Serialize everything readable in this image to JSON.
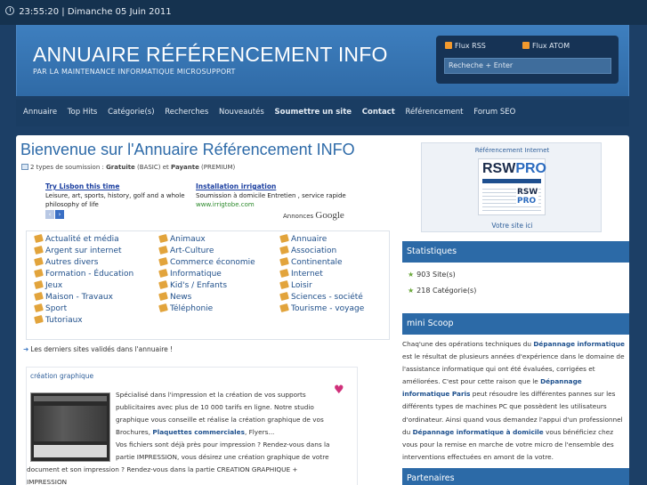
{
  "topbar": {
    "datetime": "23:55:20 | Dimanche 05 Juin 2011"
  },
  "header": {
    "title": "ANNUAIRE RÉFÉRENCEMENT INFO",
    "tagline": "PAR LA MAINTENANCE INFORMATIQUE MICROSUPPORT",
    "feed_rss": "Flux RSS",
    "feed_atom": "Flux ATOM",
    "search_value": "Recheche + Enter"
  },
  "nav": {
    "items": [
      "Annuaire",
      "Top Hits",
      "Catégorie(s)",
      "Recherches",
      "Nouveautés",
      "Soumettre un site",
      "Contact",
      "Référencement",
      "Forum SEO"
    ]
  },
  "main": {
    "title": "Bienvenue sur l'Annuaire Référencement INFO",
    "subline_prefix": "2 types de soumission : ",
    "subline_free": "Gratuite",
    "subline_basic": " (BASIC) et ",
    "subline_paid": "Payante",
    "subline_premium": " (PREMIUM)",
    "ads": [
      {
        "title": "Try Lisbon this time",
        "text": "Leisure, art, sports, history, golf and a whole philosophy of life",
        "url": ""
      },
      {
        "title": "Installation irrigation",
        "text": "Soumission à domicile Entretien , service rapide",
        "url": "www.irrigtobe.com"
      }
    ],
    "ads_by": "Annonces",
    "ads_brand": "Google",
    "categories": [
      [
        "Actualité et média",
        "Animaux",
        "Annuaire"
      ],
      [
        "Argent sur internet",
        "Art-Culture",
        "Association"
      ],
      [
        "Autres divers",
        "Commerce économie",
        "Continentale"
      ],
      [
        "Formation - Éducation",
        "Informatique",
        "Internet"
      ],
      [
        "Jeux",
        "Kid's / Enfants",
        "Loisir"
      ],
      [
        "Maison - Travaux",
        "News",
        "Sciences - société"
      ],
      [
        "Sport",
        "Téléphonie",
        "Tourisme - voyage"
      ],
      [
        "Tutoriaux",
        "",
        ""
      ]
    ],
    "latest_label": "Les derniers sites validés dans l'annuaire !",
    "card": {
      "title": "création graphique",
      "lines": [
        "Spécialisé dans l'impression et la création de vos supports",
        "publicitaires avec plus de 10 000 tarifs en ligne. Notre studio",
        "graphique vous conseille et réalise la création graphique de vos",
        "Brochures, ",
        "Plaquettes commerciales",
        ", Flyers...",
        "Vos fichiers sont déjà près pour impression ? Rendez-vous dans la",
        "partie IMPRESSION, vous désirez une création graphique de votre",
        "document et son impression ? Rendez-vous dans la partie CREATION GRAPHIQUE +",
        "IMPRESSION"
      ]
    }
  },
  "sidebar": {
    "promo_title": "Référencement Internet",
    "promo_logo_a": "RSW",
    "promo_logo_b": "PRO",
    "promo_logo_c": "RSW",
    "promo_logo_d": "PRO",
    "promo_link": "Votre site ici",
    "stats_title": "Statistiques",
    "stats": [
      "903 Site(s)",
      "218 Catégorie(s)"
    ],
    "scoop_title": "mini Scoop",
    "scoop": [
      "Chaq'une des opérations techniques du ",
      "Dépannage informatique",
      " est le résultat de plusieurs années d'expérience dans le domaine de l'assistance informatique qui ont été évaluées, corrigées et améliorées. C'est pour cette raison que le ",
      "Dépannage informatique Paris",
      " peut résoudre les différentes pannes sur les différents types de machines PC que possèdent les utilisateurs d'ordinateur. Ainsi quand vous demandez l'appui d'un professionnel du ",
      "Dépannage informatique à domicile",
      " vous bénéficiez chez vous pour la remise en marche de votre micro de l'ensemble des interventions effectuées en amont de la votre."
    ],
    "partners_title": "Partenaires"
  },
  "colors": {
    "page_bg": "#1c3f66",
    "header_blue": "#3e7fbf",
    "link_blue": "#2d6aa8",
    "panel_blue": "#2c6aa7"
  }
}
